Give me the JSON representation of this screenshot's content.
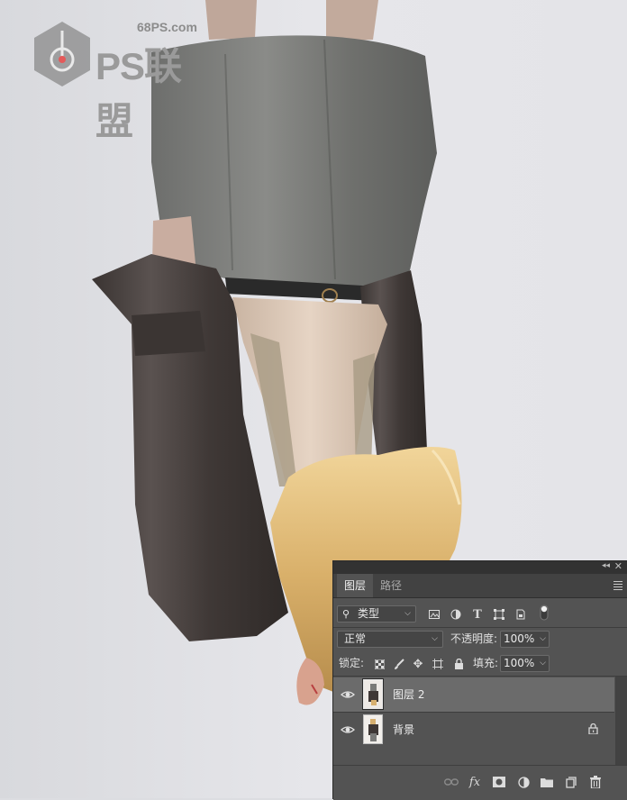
{
  "watermark": {
    "site": "68PS.com",
    "brand": "PS联盟"
  },
  "layers_panel": {
    "tabs": [
      {
        "label": "图层"
      },
      {
        "label": "路径"
      }
    ],
    "filter": {
      "search_label": "类型"
    },
    "blend_mode": "正常",
    "opacity": {
      "label": "不透明度:",
      "value": "100%"
    },
    "lock": {
      "label": "锁定:"
    },
    "fill": {
      "label": "填充:",
      "value": "100%"
    },
    "layers": [
      {
        "name": "图层 2",
        "selected": true,
        "visible": true,
        "locked": false
      },
      {
        "name": "背景",
        "selected": false,
        "visible": true,
        "locked": true
      }
    ],
    "icons": {
      "filter_kind": [
        "image-filter-icon",
        "adjustment-filter-icon",
        "type-filter-icon",
        "shape-filter-icon",
        "smart-object-filter-icon",
        "filter-toggle-icon"
      ],
      "lock": [
        "lock-transparent-pixels-icon",
        "lock-image-pixels-icon",
        "lock-position-icon",
        "lock-artboard-icon",
        "lock-all-icon"
      ],
      "bottom": [
        "link-layers-icon",
        "fx-icon",
        "add-mask-icon",
        "new-adjustment-icon",
        "new-group-icon",
        "new-layer-icon",
        "delete-layer-icon"
      ]
    }
  }
}
